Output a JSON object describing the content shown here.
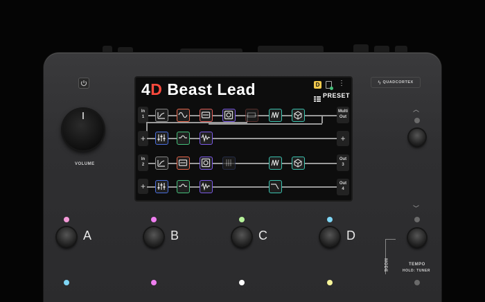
{
  "screen": {
    "preset_number": "4",
    "preset_letter": "D",
    "preset_name": "Beast Lead",
    "bank_badge": "D",
    "preset_button_label": "PRESET",
    "rows": [
      {
        "in_label": "In",
        "in_num": "1",
        "out_label": "Multi",
        "out_num": "Out"
      },
      {
        "in_label": "+",
        "out_label": "+"
      },
      {
        "in_label": "In",
        "in_num": "2",
        "out_label": "Out",
        "out_num": "3"
      },
      {
        "in_label": "+",
        "out_label": "Out",
        "out_num": "4"
      }
    ]
  },
  "device": {
    "brand": "QUADCORTEX",
    "volume_label": "VOLUME",
    "footswitches": [
      "A",
      "B",
      "C",
      "D"
    ],
    "mode_label": "MODE",
    "tempo_label": "TEMPO",
    "tempo_sub": "HOLD: TUNER"
  },
  "colors": {
    "led_a": "#f49ad8",
    "led_b": "#ef7ff0",
    "led_c": "#b6f29a",
    "led_d": "#7fd6f5",
    "block_orange": "#e9674b",
    "block_green": "#46c27c",
    "block_blue": "#4a6fe0",
    "block_purple": "#7b5ae8",
    "block_teal": "#3bc4b0",
    "block_red": "#e25c56"
  },
  "icons": {
    "power": "power-icon",
    "tuner_up": "chevron-up-icon",
    "tuner_down": "chevron-down-icon",
    "menu": "kebab-icon",
    "grid": "grid-icon"
  }
}
